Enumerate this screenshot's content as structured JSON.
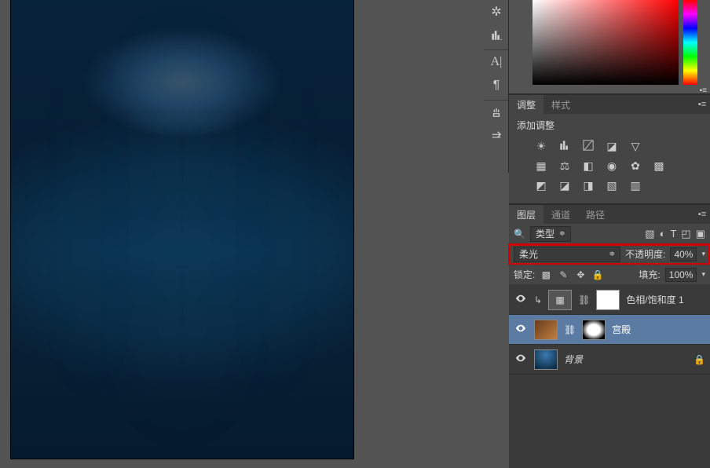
{
  "adjust_tabs": {
    "adjust": "调整",
    "styles": "样式"
  },
  "adjust": {
    "title": "添加调整"
  },
  "layers_tabs": {
    "layers": "图层",
    "channels": "通道",
    "paths": "路径"
  },
  "layers": {
    "filter_label": "类型",
    "blend_mode": "柔光",
    "opacity_label": "不透明度:",
    "opacity_value": "40%",
    "lock_label": "锁定:",
    "fill_label": "填充:",
    "fill_value": "100%",
    "items": [
      {
        "name": "色相/饱和度 1",
        "selected": false,
        "adjustment": true
      },
      {
        "name": "宫殿",
        "selected": true,
        "mask": true
      },
      {
        "name": "背景",
        "selected": false,
        "locked": true
      }
    ]
  }
}
